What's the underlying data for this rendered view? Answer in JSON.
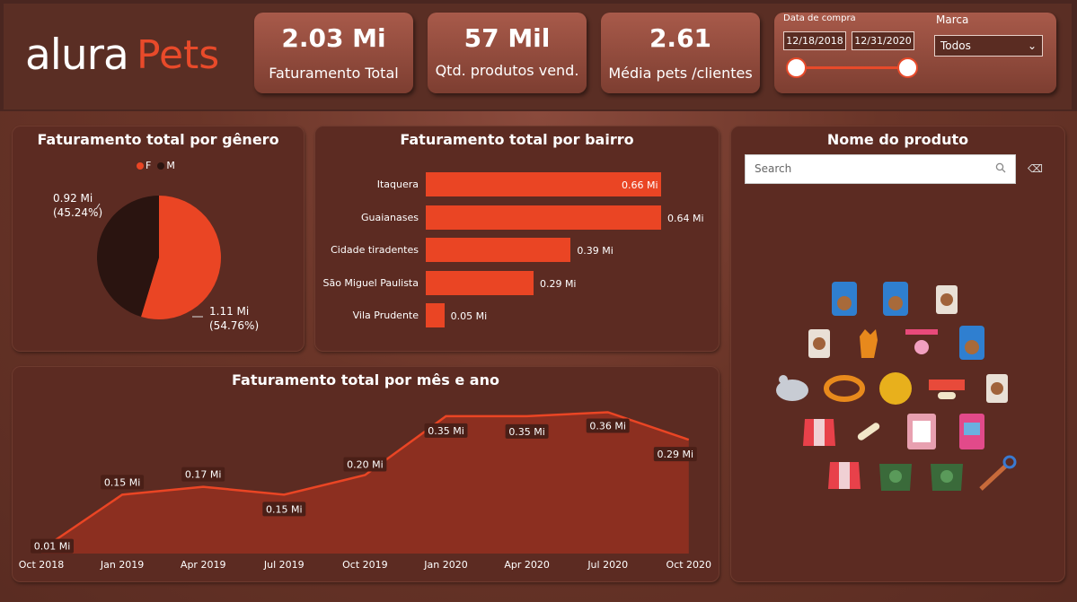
{
  "brand": {
    "word1": "alura",
    "word2": "Pets"
  },
  "kpis": [
    {
      "value": "2.03 Mi",
      "label": "Faturamento Total"
    },
    {
      "value": "57 Mil",
      "label": "Qtd. produtos vend."
    },
    {
      "value": "2.61",
      "label": "Média pets /clientes"
    }
  ],
  "filters": {
    "date_label": "Data de compra",
    "date_start": "12/18/2018",
    "date_end": "12/31/2020",
    "brand_label": "Marca",
    "brand_value": "Todos"
  },
  "gender_panel": {
    "title": "Faturamento total por gênero",
    "legend": [
      {
        "name": "F",
        "color": "#ea4524"
      },
      {
        "name": "M",
        "color": "#2a1410"
      }
    ],
    "slices": [
      {
        "name": "F",
        "value": 1.11,
        "label": "1.11 Mi",
        "pct": "(54.76%)"
      },
      {
        "name": "M",
        "value": 0.92,
        "label": "0.92 Mi",
        "pct": "(45.24%)"
      }
    ]
  },
  "bairro_panel": {
    "title": "Faturamento total por bairro",
    "bars": [
      {
        "category": "Itaquera",
        "value": 0.66,
        "label": "0.66 Mi"
      },
      {
        "category": "Guaianases",
        "value": 0.64,
        "label": "0.64 Mi"
      },
      {
        "category": "Cidade tiradentes",
        "value": 0.39,
        "label": "0.39 Mi"
      },
      {
        "category": "São Miguel Paulista",
        "value": 0.29,
        "label": "0.29 Mi"
      },
      {
        "category": "Vila Prudente",
        "value": 0.05,
        "label": "0.05 Mi"
      }
    ]
  },
  "product_panel": {
    "title": "Nome do produto",
    "search_placeholder": "Search",
    "icons": [
      "dog-food-bag-icon",
      "dog-food-bag-icon",
      "pet-food-bag-icon",
      "pet-food-bag-icon",
      "cat-icon",
      "collar-tag-icon",
      "dog-food-bag-icon",
      "toy-mouse-icon",
      "collar-icon",
      "ball-toy-icon",
      "collar-bone-icon",
      "pet-food-bag-icon",
      "pet-coat-icon",
      "bone-icon",
      "bone-box-icon",
      "pet-food-can-icon",
      "pet-coat-icon",
      "pet-sweater-icon",
      "pet-sweater-icon",
      "leash-icon"
    ]
  },
  "monthly_panel": {
    "title": "Faturamento total por mês e ano"
  },
  "chart_data": [
    {
      "type": "pie",
      "title": "Faturamento total por gênero",
      "categories": [
        "F",
        "M"
      ],
      "values": [
        1.11,
        0.92
      ]
    },
    {
      "type": "bar",
      "title": "Faturamento total por bairro",
      "categories": [
        "Itaquera",
        "Guaianases",
        "Cidade tiradentes",
        "São Miguel Paulista",
        "Vila Prudente"
      ],
      "values": [
        0.66,
        0.64,
        0.39,
        0.29,
        0.05
      ]
    },
    {
      "type": "area",
      "title": "Faturamento total por mês e ano",
      "x_ticks": [
        "Oct 2018",
        "Jan 2019",
        "Apr 2019",
        "Jul 2019",
        "Oct 2019",
        "Jan 2020",
        "Apr 2020",
        "Jul 2020",
        "Oct 2020"
      ],
      "points": [
        {
          "x": "Oct 2018",
          "y": 0.01,
          "label": "0.01 Mi"
        },
        {
          "x": "Jan 2019",
          "y": 0.15,
          "label": "0.15 Mi"
        },
        {
          "x": "Apr 2019",
          "y": 0.17,
          "label": "0.17 Mi"
        },
        {
          "x": "Jul 2019",
          "y": 0.15,
          "label": "0.15 Mi"
        },
        {
          "x": "Oct 2019",
          "y": 0.2,
          "label": "0.20 Mi"
        },
        {
          "x": "Jan 2020",
          "y": 0.35,
          "label": "0.35 Mi"
        },
        {
          "x": "Apr 2020",
          "y": 0.35,
          "label": "0.35 Mi"
        },
        {
          "x": "Jul 2020",
          "y": 0.36,
          "label": "0.36 Mi"
        },
        {
          "x": "Oct 2020",
          "y": 0.29,
          "label": "0.29 Mi"
        }
      ],
      "ylim": [
        0,
        0.4
      ]
    }
  ]
}
